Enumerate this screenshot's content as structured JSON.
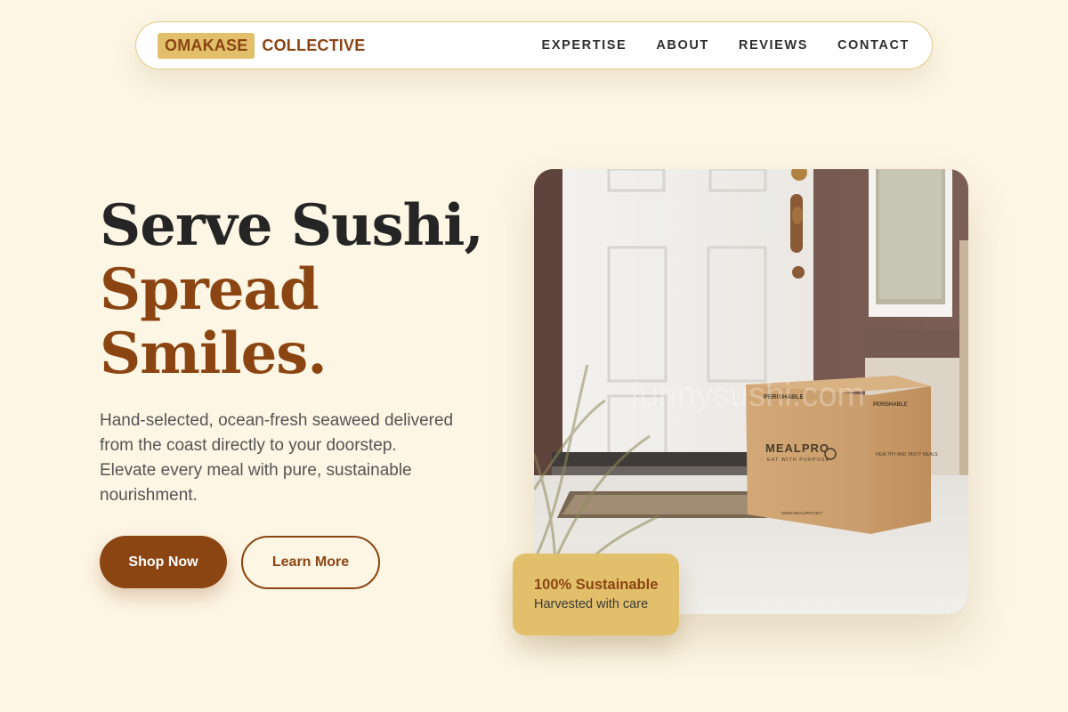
{
  "nav": {
    "brand_highlight": "OMAKASE",
    "brand_text": "COLLECTIVE",
    "links": [
      "EXPERTISE",
      "ABOUT",
      "REVIEWS",
      "CONTACT"
    ]
  },
  "hero": {
    "headline_line1": "Serve Sushi,",
    "headline_line2": "Spread",
    "headline_line3": "Smiles.",
    "subtext": "Hand-selected, ocean-fresh seaweed delivered from the coast directly to your doorstep. Elevate every meal with pure, sustainable nourishment.",
    "primary_button": "Shop Now",
    "secondary_button": "Learn More"
  },
  "image": {
    "box_brand": "MEALPRO",
    "box_tagline": "EAT WITH PURPOSE",
    "box_label": "PERISHABLE",
    "box_side": "HEALTHY AND TASTY MEALS",
    "box_url": "WWW.MEALPRO.NET",
    "watermark": "funnysushi.com",
    "icon": "doorstep-delivery-photo"
  },
  "badge": {
    "title": "100% Sustainable",
    "subtitle": "Harvested with care"
  },
  "colors": {
    "background": "#fdf6e4",
    "accent_brown": "#8b4513",
    "accent_gold": "#e2c06b",
    "text_dark": "#252525",
    "text_muted": "#545454"
  }
}
